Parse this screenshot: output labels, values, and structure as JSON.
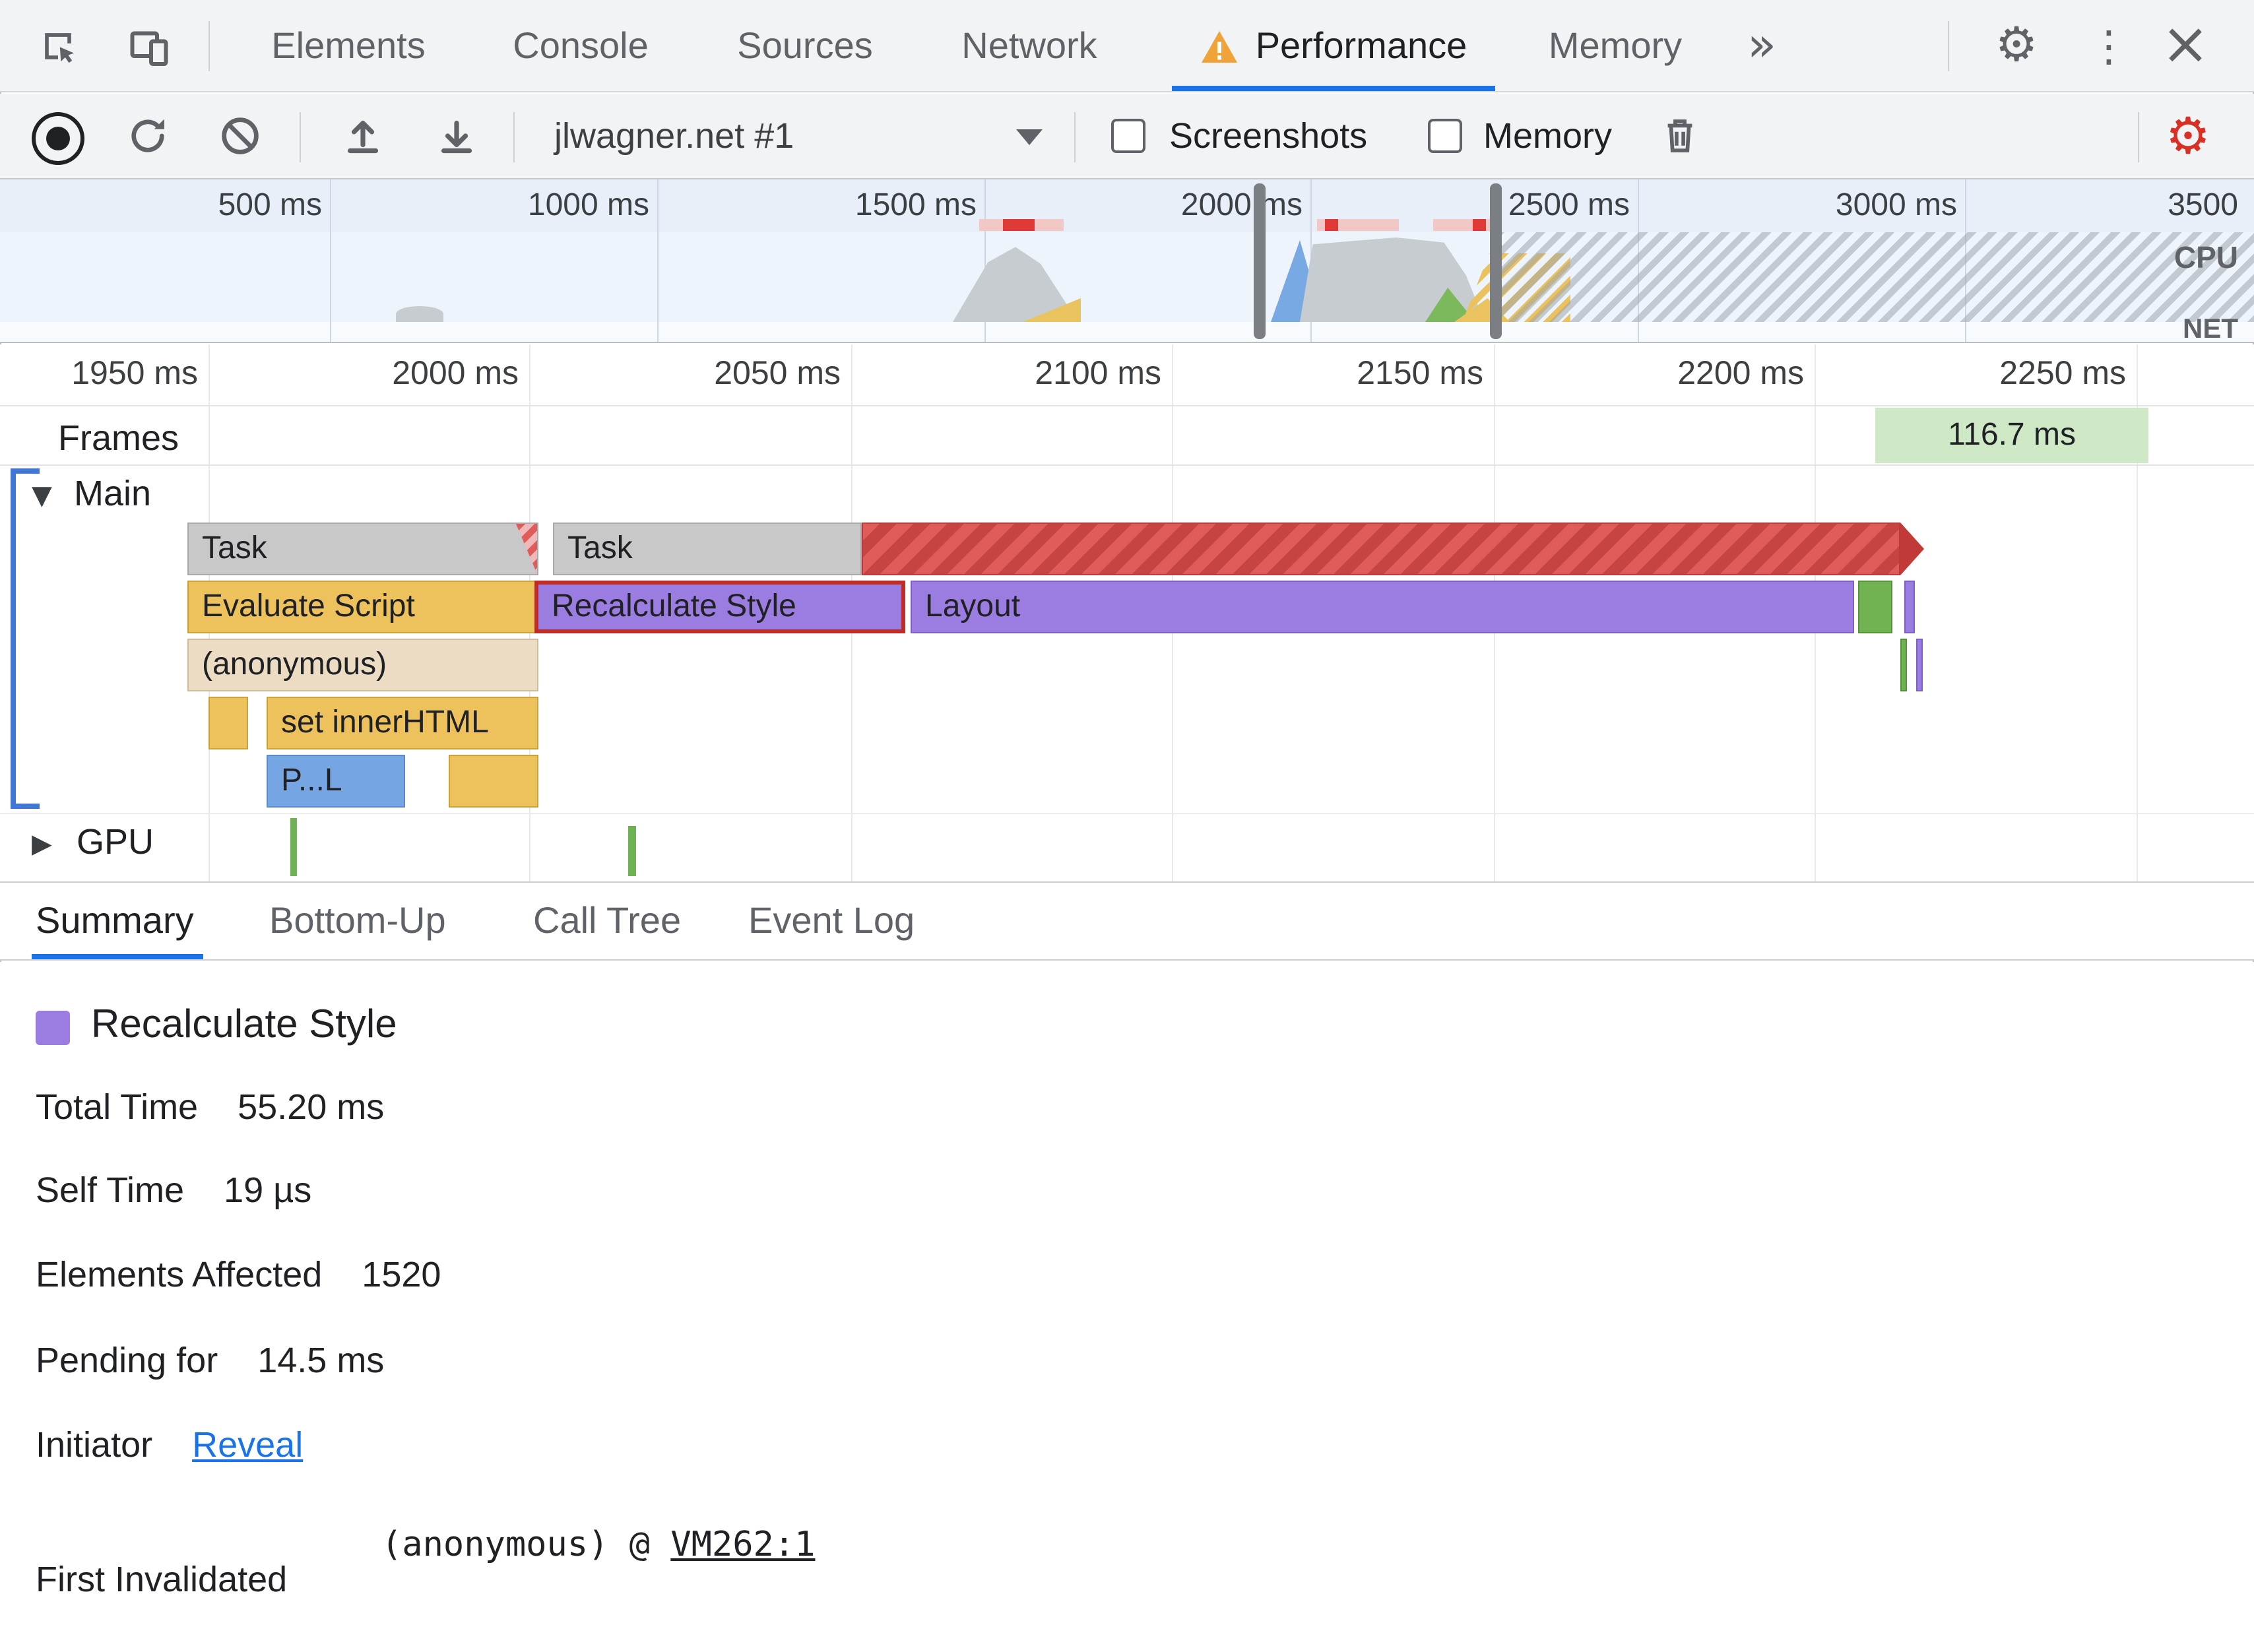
{
  "colors": {
    "accent_blue": "#1a73e8",
    "warning_orange": "#efa338",
    "settings_red": "#d93025",
    "task_gray": "#c8c8c8",
    "script_yellow": "#edc25c",
    "style_purple": "#9b7ce0",
    "parse_blue": "#76a5e3",
    "paint_green": "#71b352",
    "frame_green": "#cfe9c6",
    "selection_red": "#bf2b26"
  },
  "tabs_bar": {
    "tabs": [
      {
        "label": "Elements"
      },
      {
        "label": "Console"
      },
      {
        "label": "Sources"
      },
      {
        "label": "Network"
      },
      {
        "label": "Performance"
      },
      {
        "label": "Memory"
      }
    ],
    "active_tab": "Performance",
    "icons": {
      "more_tabs": "»",
      "settings": "⚙",
      "menu": "⋮",
      "close": "×"
    }
  },
  "toolbar": {
    "profile_select_value": "jlwagner.net #1",
    "screenshots_label": "Screenshots",
    "memory_label": "Memory",
    "screenshots_checked": false,
    "memory_checked": false,
    "settings_icon": "⚙"
  },
  "overview": {
    "tick_labels": [
      "500 ms",
      "1000 ms",
      "1500 ms",
      "2000 ms",
      "2500 ms",
      "3000 ms",
      "3500"
    ],
    "cpu_label": "CPU",
    "net_label": "NET"
  },
  "waterfall": {
    "tick_labels": [
      "1950 ms",
      "2000 ms",
      "2050 ms",
      "2100 ms",
      "2150 ms",
      "2200 ms",
      "2250 ms"
    ],
    "frames_label": "Frames",
    "frame_duration": "116.7 ms",
    "main_track_label": "Main",
    "gpu_track_label": "GPU",
    "main_collapsed_glyph": "▼",
    "gpu_collapsed_glyph": "▶",
    "bars": {
      "task1": "Task",
      "task2": "Task",
      "evaluate_script": "Evaluate Script",
      "recalculate_style": "Recalculate Style",
      "layout": "Layout",
      "anonymous": "(anonymous)",
      "set_inner_html": "set innerHTML",
      "parse_html": "P...L"
    }
  },
  "bottom_tabs": {
    "tabs": [
      {
        "label": "Summary"
      },
      {
        "label": "Bottom-Up"
      },
      {
        "label": "Call Tree"
      },
      {
        "label": "Event Log"
      }
    ],
    "active_tab": "Summary"
  },
  "summary": {
    "title": "Recalculate Style",
    "stats": [
      {
        "label": "Total Time",
        "value": "55.20 ms"
      },
      {
        "label": "Self Time",
        "value": "19 µs"
      },
      {
        "label": "Elements Affected",
        "value": "1520"
      },
      {
        "label": "Pending for",
        "value": "14.5 ms"
      }
    ],
    "initiator_label": "Initiator",
    "initiator_link": "Reveal",
    "first_invalidated_label": "First Invalidated",
    "first_invalidated_text": "(anonymous) @ ",
    "first_invalidated_link": "VM262:1"
  }
}
